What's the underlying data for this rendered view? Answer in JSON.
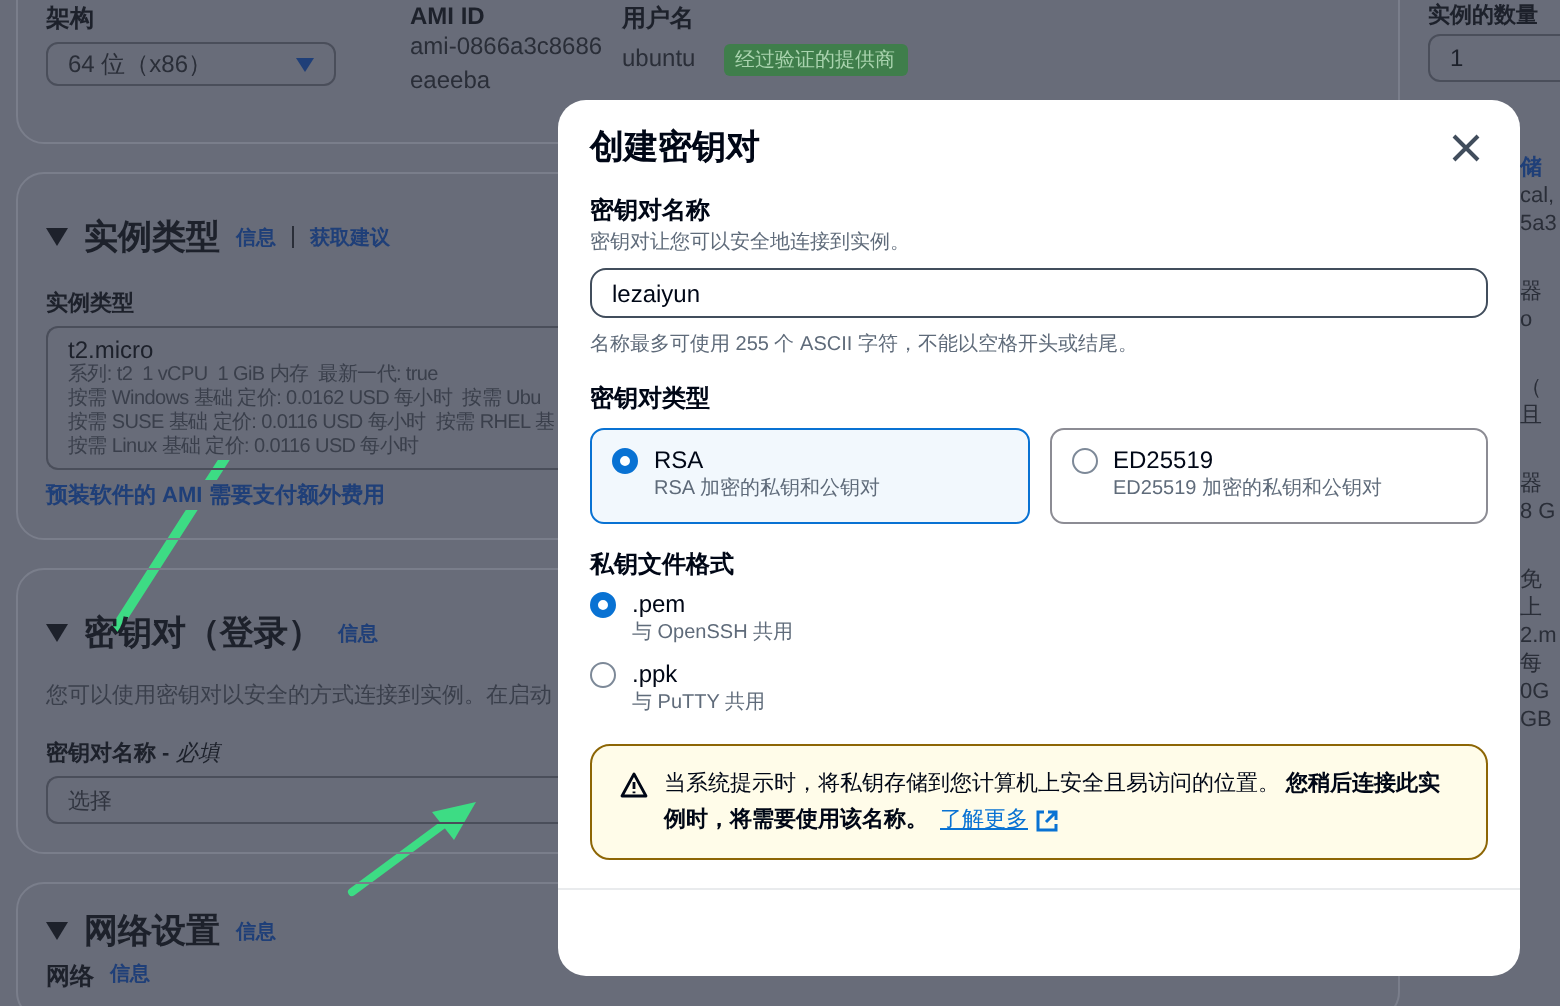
{
  "background": {
    "architecture": {
      "label": "架构",
      "value": "64 位（x86）"
    },
    "ami": {
      "label": "AMI ID",
      "value_lines": [
        "ami-0866a3c8686",
        "eaeeba"
      ]
    },
    "username": {
      "label": "用户名",
      "value": "ubuntu",
      "badge": "经过验证的提供商"
    },
    "instance_count": {
      "label": "实例的数量",
      "value": "1"
    },
    "instance_type": {
      "title": "实例类型",
      "links": [
        "信息",
        "获取建议"
      ],
      "field_label": "实例类型",
      "selected_type": "t2.micro",
      "detail_lines": [
        [
          "系列: t2",
          "1 vCPU",
          "1 GiB 内存",
          "最新一代: true"
        ],
        [
          "按需 Windows 基础 定价: 0.0162 USD 每小时",
          "按需 Ubu"
        ],
        [
          "按需 SUSE 基础 定价: 0.0116 USD 每小时",
          "按需 RHEL 基"
        ],
        [
          "按需 Linux 基础 定价: 0.0116 USD 每小时"
        ]
      ],
      "note_link": "预装软件的 AMI 需要支付额外费用"
    },
    "key_pair": {
      "title": "密钥对（登录）",
      "info_link": "信息",
      "description": "您可以使用密钥对以安全的方式连接到实例。在启动",
      "field_label": "密钥对名称 - *必填*",
      "placeholder": "选择"
    },
    "network": {
      "title": "网络设置",
      "info_link": "信息",
      "field_label": "网络",
      "field_info_link": "信息"
    },
    "summary_fragments": [
      [
        "储",
        "cal,",
        "5a3"
      ],
      [
        "器",
        "o"
      ],
      [
        "（",
        "且"
      ],
      [
        "器",
        "8 G"
      ],
      [
        "免",
        "上",
        "2.m",
        "每",
        "0G",
        "GB"
      ]
    ]
  },
  "dialog": {
    "title": "创建密钥对",
    "name_field": {
      "label": "密钥对名称",
      "description": "密钥对让您可以安全地连接到实例。",
      "value": "lezaiyun",
      "hint": "名称最多可使用 255 个 ASCII 字符，不能以空格开头或结尾。"
    },
    "key_type": {
      "label": "密钥对类型",
      "options": [
        {
          "label": "RSA",
          "description": "RSA 加密的私钥和公钥对",
          "selected": true
        },
        {
          "label": "ED25519",
          "description": "ED25519 加密的私钥和公钥对",
          "selected": false
        }
      ]
    },
    "file_format": {
      "label": "私钥文件格式",
      "options": [
        {
          "label": ".pem",
          "description": "与 OpenSSH 共用",
          "selected": true
        },
        {
          "label": ".ppk",
          "description": "与 PuTTY 共用",
          "selected": false
        }
      ]
    },
    "alert": {
      "text": "当系统提示时，将私钥存储到您计算机上安全且易访问的位置。 **您稍后连接此实例时，将需要使用该名称。**",
      "link": "了解更多"
    }
  }
}
